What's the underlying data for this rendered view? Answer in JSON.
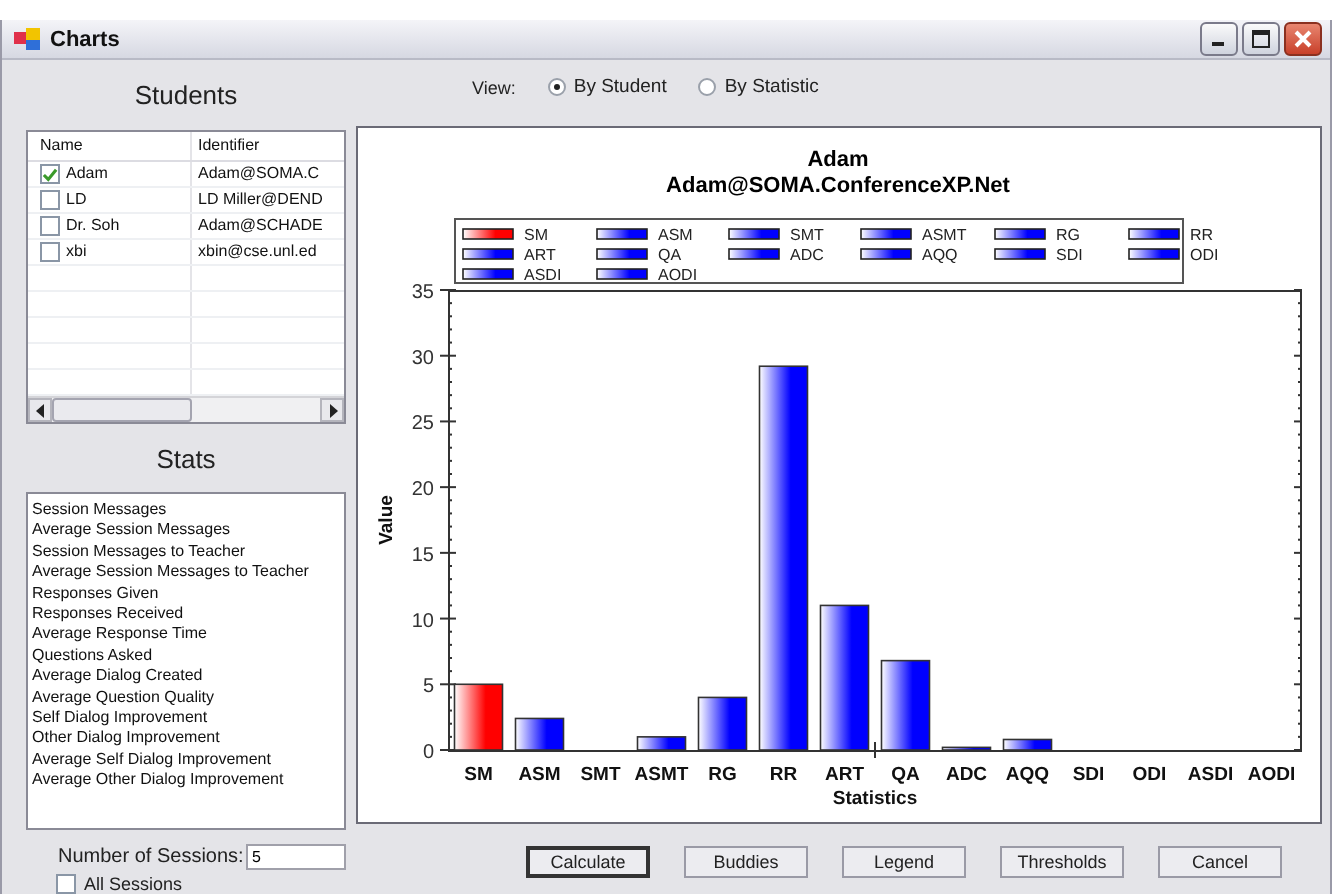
{
  "window": {
    "title": "Charts"
  },
  "students": {
    "heading": "Students",
    "columns": [
      "Name",
      "Identifier"
    ],
    "rows": [
      {
        "name": "Adam",
        "identifier": "Adam@SOMA.C",
        "checked": true
      },
      {
        "name": "LD",
        "identifier": "LD Miller@DEND",
        "checked": false
      },
      {
        "name": "Dr. Soh",
        "identifier": "Adam@SCHADE",
        "checked": false
      },
      {
        "name": "xbi",
        "identifier": "xbin@cse.unl.ed",
        "checked": false
      }
    ]
  },
  "stats": {
    "heading": "Stats",
    "items": [
      "Session Messages",
      "Average Session Messages",
      "Session Messages to Teacher",
      "Average Session Messages to Teacher",
      "Responses Given",
      "Responses Received",
      "Average Response Time",
      "Questions Asked",
      "Average Dialog Created",
      "Average Question Quality",
      "Self Dialog Improvement",
      "Other Dialog Improvement",
      "Average Self Dialog Improvement",
      "Average Other Dialog Improvement"
    ]
  },
  "sessions": {
    "label": "Number of Sessions:",
    "value": "5",
    "all_sessions": {
      "label": "All Sessions",
      "checked": false
    }
  },
  "view": {
    "label": "View:",
    "options": [
      {
        "label": "By Student",
        "selected": true
      },
      {
        "label": "By Statistic",
        "selected": false
      }
    ]
  },
  "chart": {
    "title": "Adam",
    "subtitle": "Adam@SOMA.ConferenceXP.Net",
    "legend": [
      {
        "label": "SM",
        "color": "#ff0000"
      },
      {
        "label": "ASM",
        "color": "#0000ff"
      },
      {
        "label": "SMT",
        "color": "#0000ff"
      },
      {
        "label": "ASMT",
        "color": "#0000ff"
      },
      {
        "label": "RG",
        "color": "#0000ff"
      },
      {
        "label": "RR",
        "color": "#0000ff"
      },
      {
        "label": "ART",
        "color": "#0000ff"
      },
      {
        "label": "QA",
        "color": "#0000ff"
      },
      {
        "label": "ADC",
        "color": "#0000ff"
      },
      {
        "label": "AQQ",
        "color": "#0000ff"
      },
      {
        "label": "SDI",
        "color": "#0000ff"
      },
      {
        "label": "ODI",
        "color": "#0000ff"
      },
      {
        "label": "ASDI",
        "color": "#0000ff"
      },
      {
        "label": "AODI",
        "color": "#0000ff"
      }
    ],
    "chart_data": {
      "type": "bar",
      "xlabel": "Statistics",
      "ylabel": "Value",
      "categories": [
        "SM",
        "ASM",
        "SMT",
        "ASMT",
        "RG",
        "RR",
        "ART",
        "QA",
        "ADC",
        "AQQ",
        "SDI",
        "ODI",
        "ASDI",
        "AODI"
      ],
      "values": [
        5,
        2.4,
        0,
        1,
        4,
        29.2,
        11,
        6.8,
        0.2,
        0.8,
        0,
        0,
        0,
        0
      ],
      "ylim": [
        0,
        35
      ],
      "yticks": [
        0,
        5,
        10,
        15,
        20,
        25,
        30,
        35
      ]
    }
  },
  "buttons": [
    {
      "label": "Calculate",
      "default": true
    },
    {
      "label": "Buddies",
      "default": false
    },
    {
      "label": "Legend",
      "default": false
    },
    {
      "label": "Thresholds",
      "default": false
    },
    {
      "label": "Cancel",
      "default": false
    }
  ]
}
